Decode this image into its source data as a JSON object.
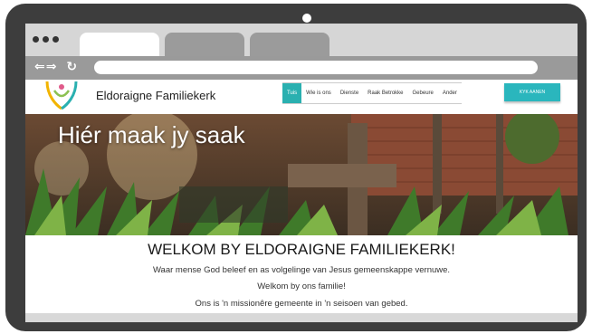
{
  "site": {
    "name": "Eldoraigne Familiekerk",
    "menu": [
      "Tuis",
      "Wie is ons",
      "Dienste",
      "Raak Betrokke",
      "Gebeure",
      "Ander"
    ],
    "active_menu": "Tuis",
    "cta_label": "KYK AANEN",
    "accent": "#2ab0b0"
  },
  "hero": {
    "title": "Hiér maak jy saak"
  },
  "content": {
    "heading": "WELKOM BY ELDORAIGNE FAMILIEKERK!",
    "line1": "Waar mense God beleef en as volgelinge van Jesus gemeenskappe vernuwe.",
    "line2": "Welkom by ons familie!",
    "line3": "Ons is 'n missionêre gemeente in 'n seisoen van gebed."
  },
  "browser": {
    "frame_color": "#3d3d3d",
    "icons": [
      "back-icon",
      "forward-icon",
      "reload-icon"
    ]
  }
}
